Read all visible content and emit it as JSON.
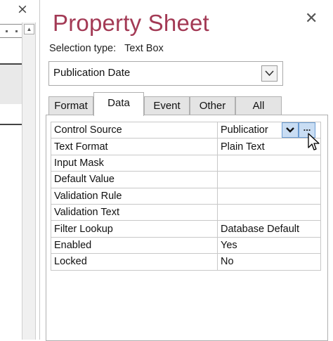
{
  "left_pane": {
    "close_glyph": "×"
  },
  "sheet": {
    "title": "Property Sheet",
    "close_glyph": "✕",
    "selection_type_label": "Selection type:",
    "selection_type_value": "Text Box",
    "object_selector_value": "Publication Date",
    "tabs": [
      {
        "label": "Format",
        "active": false
      },
      {
        "label": "Data",
        "active": true
      },
      {
        "label": "Event",
        "active": false
      },
      {
        "label": "Other",
        "active": false
      },
      {
        "label": "All",
        "active": false
      }
    ],
    "properties": [
      {
        "label": "Control Source",
        "value": "Publicatior"
      },
      {
        "label": "Text Format",
        "value": "Plain Text"
      },
      {
        "label": "Input Mask",
        "value": ""
      },
      {
        "label": "Default Value",
        "value": ""
      },
      {
        "label": "Validation Rule",
        "value": ""
      },
      {
        "label": "Validation Text",
        "value": ""
      },
      {
        "label": "Filter Lookup",
        "value": "Database Default"
      },
      {
        "label": "Enabled",
        "value": "Yes"
      },
      {
        "label": "Locked",
        "value": "No"
      }
    ],
    "build_button_glyph": "..."
  },
  "colors": {
    "title": "#a33a55",
    "button_highlight": "#c9ddf3"
  }
}
